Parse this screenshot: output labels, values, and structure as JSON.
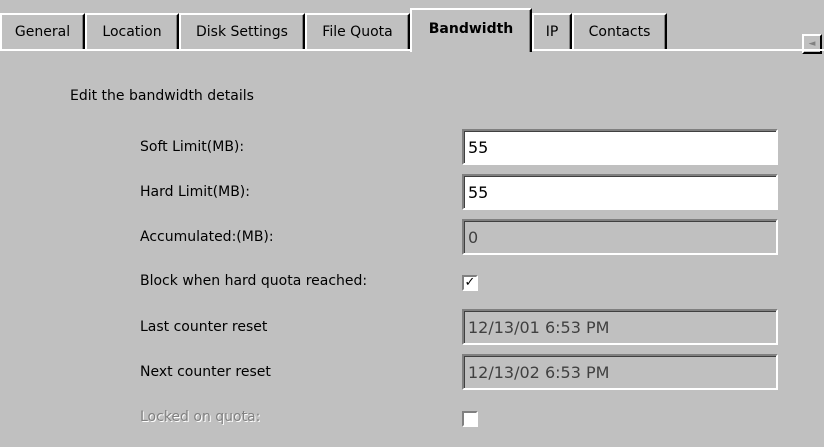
{
  "tabs": [
    {
      "label": "General"
    },
    {
      "label": "Location"
    },
    {
      "label": "Disk Settings"
    },
    {
      "label": "File Quota"
    },
    {
      "label": "Bandwidth"
    },
    {
      "label": "IP"
    },
    {
      "label": "Contacts"
    }
  ],
  "active_tab": "Bandwidth",
  "scroll_arrow_glyph": "◄",
  "panel": {
    "heading": "Edit the bandwidth details",
    "soft_limit": {
      "label": "Soft Limit(MB):",
      "value": "55"
    },
    "hard_limit": {
      "label": "Hard Limit(MB):",
      "value": "55"
    },
    "accumulated": {
      "label": "Accumulated:(MB):",
      "value": "0"
    },
    "block_when_hard_quota": {
      "label": "Block when hard quota reached:",
      "checked": true,
      "glyph": "✓"
    },
    "last_counter_reset": {
      "label": "Last counter reset",
      "value": "12/13/01 6:53 PM"
    },
    "next_counter_reset": {
      "label": "Next counter reset",
      "value": "12/13/02 6:53 PM"
    },
    "locked_on_quota": {
      "label": "Locked on quota:",
      "checked": false,
      "glyph": ""
    }
  },
  "colors": {
    "face": "#c0c0c0",
    "highlight": "#ffffff",
    "shadow": "#808080",
    "dark_shadow": "#000000"
  }
}
